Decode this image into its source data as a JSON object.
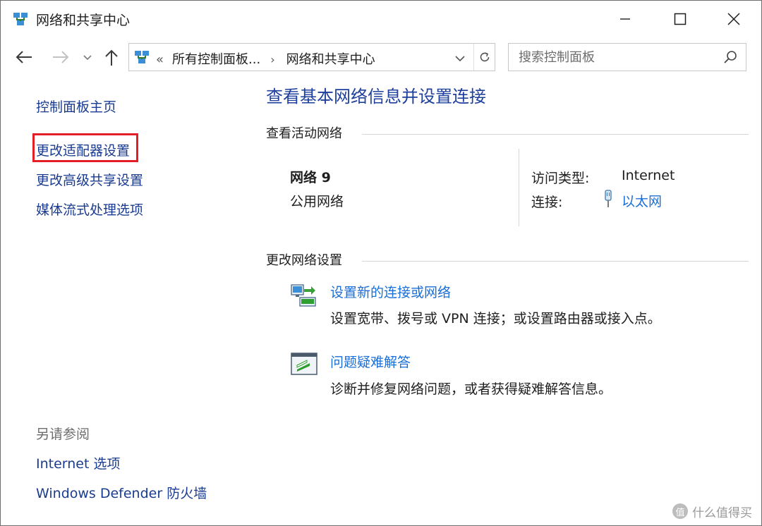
{
  "window": {
    "title": "网络和共享中心"
  },
  "address_bar": {
    "overflow": "«",
    "crumbs": [
      "所有控制面板...",
      "网络和共享中心"
    ],
    "separator": "›"
  },
  "search": {
    "placeholder": "搜索控制面板"
  },
  "sidebar": {
    "links": [
      {
        "label": "控制面板主页"
      },
      {
        "label": "更改适配器设置",
        "highlighted": true
      },
      {
        "label": "更改高级共享设置"
      },
      {
        "label": "媒体流式处理选项"
      }
    ],
    "see_also_heading": "另请参阅",
    "see_also": [
      {
        "label": "Internet 选项"
      },
      {
        "label": "Windows Defender 防火墙"
      }
    ]
  },
  "main": {
    "title": "查看基本网络信息并设置连接",
    "active_networks_heading": "查看活动网络",
    "network": {
      "name": "网络 9",
      "profile": "公用网络",
      "access_type_label": "访问类型:",
      "access_type_value": "Internet",
      "connections_label": "连接:",
      "connection_name": "以太网"
    },
    "change_settings_heading": "更改网络设置",
    "tasks": [
      {
        "title": "设置新的连接或网络",
        "description": "设置宽带、拨号或 VPN 连接；或设置路由器或接入点。",
        "icon": "network-setup-icon"
      },
      {
        "title": "问题疑难解答",
        "description": "诊断并修复网络问题，或者获得疑难解答信息。",
        "icon": "troubleshoot-icon"
      }
    ]
  },
  "watermark": {
    "badge": "值",
    "text": "什么值得买"
  },
  "colors": {
    "link_blue": "#1a6ed8",
    "title_blue": "#1e3f9b",
    "highlight_red": "#e41e26"
  }
}
